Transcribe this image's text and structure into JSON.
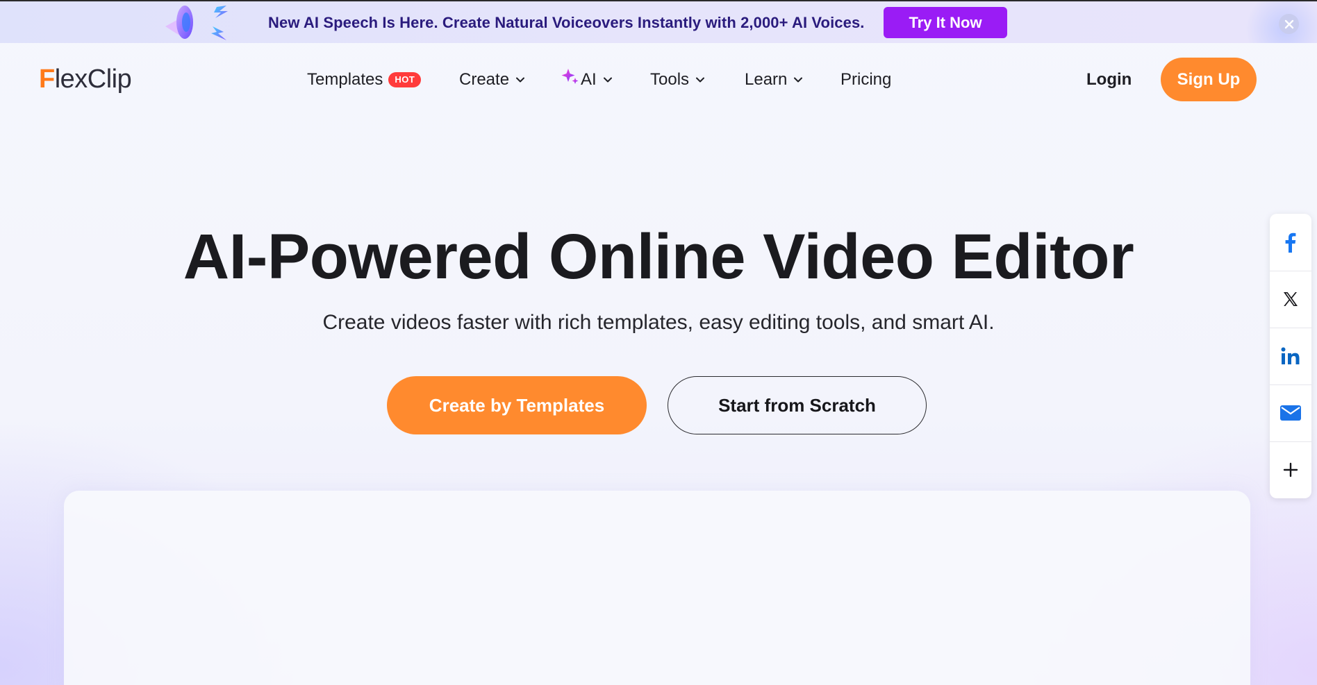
{
  "banner": {
    "text": "New AI Speech Is Here. Create Natural Voiceovers Instantly with 2,000+ AI Voices.",
    "cta_label": "Try It Now",
    "art_icon": "megaphone-icon",
    "close_icon": "close-icon"
  },
  "header": {
    "logo": "FlexClip",
    "nav": [
      {
        "label": "Templates",
        "badge": "HOT"
      },
      {
        "label": "Create",
        "dropdown": true
      },
      {
        "label": "AI",
        "dropdown": true,
        "icon": "sparkle-icon"
      },
      {
        "label": "Tools",
        "dropdown": true
      },
      {
        "label": "Learn",
        "dropdown": true
      },
      {
        "label": "Pricing"
      }
    ],
    "login_label": "Login",
    "signup_label": "Sign Up"
  },
  "hero": {
    "title": "AI-Powered Online Video Editor",
    "subtitle": "Create videos faster with rich templates, easy editing tools, and smart AI.",
    "primary_cta": "Create by Templates",
    "secondary_cta": "Start from Scratch"
  },
  "share_bar": {
    "items": [
      "facebook-icon",
      "x-icon",
      "linkedin-icon",
      "email-icon",
      "plus-icon"
    ]
  },
  "colors": {
    "accent_orange": "#ff8a2e",
    "banner_button": "#9a1cf5",
    "banner_text": "#2a1b7d",
    "hot_badge": "#ff3b3b",
    "facebook": "#1877f2",
    "linkedin": "#0a66c2"
  }
}
